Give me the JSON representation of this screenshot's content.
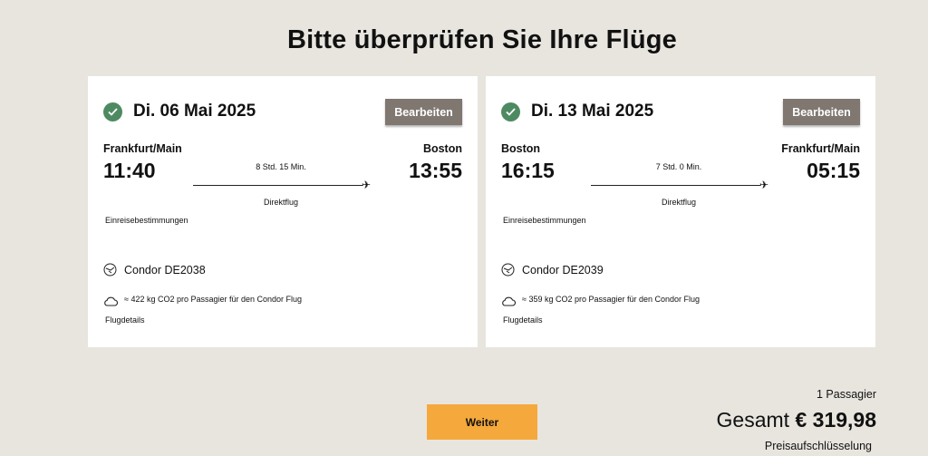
{
  "page": {
    "title": "Bitte überprüfen Sie Ihre Flüge"
  },
  "flights": [
    {
      "date": "Di. 06 Mai 2025",
      "edit_label": "Bearbeiten",
      "from_city": "Frankfurt/Main",
      "to_city": "Boston",
      "depart_time": "11:40",
      "arrive_time": "13:55",
      "duration": "8 Std. 15 Min.",
      "flight_type": "Direktflug",
      "entry_requirements": "Einreisebestimmungen",
      "airline": "Condor DE2038",
      "co2": "≈ 422 kg CO2 pro Passagier für den Condor Flug",
      "details_link": "Flugdetails"
    },
    {
      "date": "Di. 13 Mai 2025",
      "edit_label": "Bearbeiten",
      "from_city": "Boston",
      "to_city": "Frankfurt/Main",
      "depart_time": "16:15",
      "arrive_time": "05:15",
      "duration": "7 Std. 0 Min.",
      "flight_type": "Direktflug",
      "entry_requirements": "Einreisebestimmungen",
      "airline": "Condor DE2039",
      "co2": "≈ 359 kg CO2 pro Passagier für den Condor Flug",
      "details_link": "Flugdetails"
    }
  ],
  "summary": {
    "continue_label": "Weiter",
    "passengers": "1 Passagier",
    "total_label": "Gesamt",
    "total_amount": "€ 319,98",
    "breakdown_link": "Preisaufschlüsselung"
  },
  "icons": {
    "check": "check-circle-icon",
    "plane": "airplane-icon",
    "airline": "condor-logo-icon",
    "co2": "cloud-icon"
  },
  "colors": {
    "background": "#e8e5df",
    "check_green": "#4e8a61",
    "edit_button": "#7f7770",
    "continue_button": "#f5a83b"
  }
}
